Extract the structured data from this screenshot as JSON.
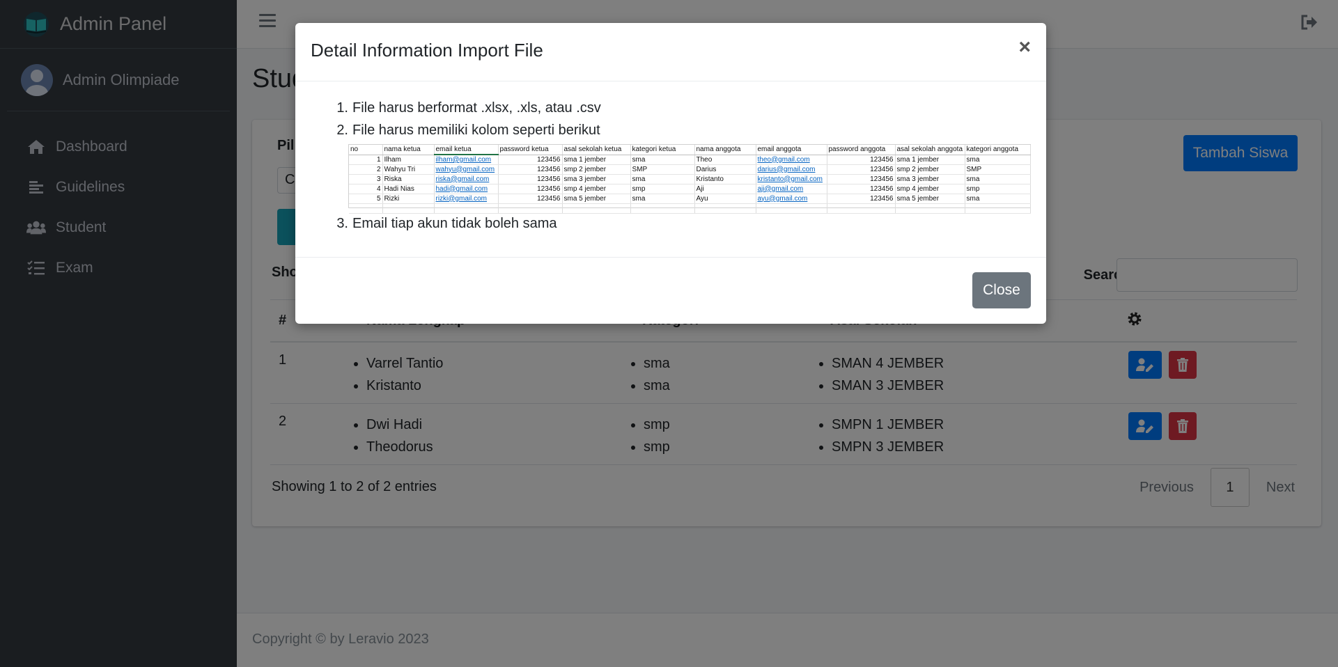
{
  "brand": {
    "title": "Admin Panel"
  },
  "user": {
    "name": "Admin Olimpiade"
  },
  "sidebar": {
    "items": [
      {
        "label": "Dashboard",
        "icon": "home-icon"
      },
      {
        "label": "Guidelines",
        "icon": "align-left-icon"
      },
      {
        "label": "Student",
        "icon": "users-icon"
      },
      {
        "label": "Exam",
        "icon": "tasks-icon"
      }
    ]
  },
  "page": {
    "title": "Student"
  },
  "card": {
    "pilih_label": "Pil",
    "select_value": "Cl",
    "add_button": "Tambah Siswa",
    "show_label": "Sho",
    "search_label": "Search:",
    "search_placeholder": ""
  },
  "table": {
    "headers": [
      "#",
      "Nama Lengkap",
      "Kategori",
      "Asal Sekolah"
    ],
    "rows": [
      {
        "no": "1",
        "names": [
          "Varrel Tantio",
          "Kristanto"
        ],
        "kategori": [
          "sma",
          "sma"
        ],
        "sekolah": [
          "SMAN 4 JEMBER",
          "SMAN 3 JEMBER"
        ]
      },
      {
        "no": "2",
        "names": [
          "Dwi Hadi",
          "Theodorus"
        ],
        "kategori": [
          "smp",
          "smp"
        ],
        "sekolah": [
          "SMPN 1 JEMBER",
          "SMPN 3 JEMBER"
        ]
      }
    ],
    "showing": "Showing 1 to 2 of 2 entries",
    "pagination": {
      "previous": "Previous",
      "current": "1",
      "next": "Next"
    }
  },
  "footer": {
    "text": "Copyright © by Leravio 2023"
  },
  "modal": {
    "title": "Detail Information Import File",
    "close_x": "×",
    "items": [
      "File harus berformat .xlsx, .xls, atau .csv",
      "File harus memiliki kolom seperti berikut",
      "Email tiap akun tidak boleh sama"
    ],
    "close_button": "Close",
    "sheet": {
      "headers": [
        "no",
        "nama ketua",
        "email ketua",
        "password ketua",
        "asal sekolah ketua",
        "kategori ketua",
        "nama anggota",
        "email anggota",
        "password anggota",
        "asal sekolah anggota",
        "kategori anggota"
      ],
      "rows": [
        [
          "1",
          "Ilham",
          "ilham@gmail.com",
          "123456",
          "sma 1 jember",
          "sma",
          "Theo",
          "theo@gmail.com",
          "123456",
          "sma 1 jember",
          "sma"
        ],
        [
          "2",
          "Wahyu Tri",
          "wahyu@gmail.com",
          "123456",
          "smp 2 jember",
          "SMP",
          "Darius",
          "darius@gmail.com",
          "123456",
          "smp 2 jember",
          "SMP"
        ],
        [
          "3",
          "Riska",
          "riska@gmail.com",
          "123456",
          "sma 3 jember",
          "sma",
          "Kristanto",
          "kristanto@gmail.com",
          "123456",
          "sma 3 jember",
          "sma"
        ],
        [
          "4",
          "Hadi Nias",
          "hadi@gmail.com",
          "123456",
          "smp 4 jember",
          "smp",
          "Aji",
          "aji@gmail.com",
          "123456",
          "smp 4 jember",
          "smp"
        ],
        [
          "5",
          "Rizki",
          "rizki@gmail.com",
          "123456",
          "sma 5 jember",
          "sma",
          "Ayu",
          "ayu@gmail.com",
          "123456",
          "sma 5 jember",
          "sma"
        ]
      ]
    }
  },
  "colors": {
    "sidebar": "#343a40",
    "primary": "#007bff",
    "danger": "#dc3545",
    "info": "#17a2b8",
    "secondary": "#6c757d"
  }
}
